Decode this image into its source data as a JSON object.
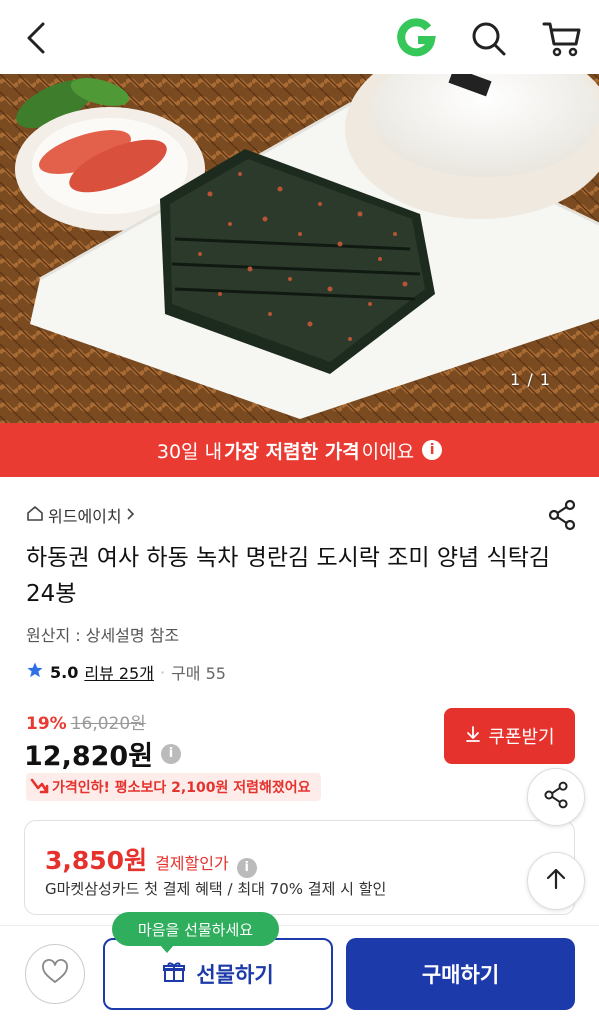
{
  "header": {
    "back_icon": "chevron-left-icon",
    "logo_icon": "g-logo-icon",
    "search_icon": "search-icon",
    "cart_icon": "cart-icon",
    "logo_color": "#35c759"
  },
  "hero": {
    "counter": "1 / 1"
  },
  "banner": {
    "prefix": "30일 내 ",
    "strong": "가장 저렴한 가격",
    "suffix": "이에요",
    "color": "#ea3b32"
  },
  "product": {
    "seller": "위드에이치",
    "title": "하동권 여사 하동 녹차 명란김 도시락 조미 양념 식탁김 24봉",
    "origin": "원산지 : 상세설명 참조",
    "rating": "5.0",
    "review_label": "리뷰 25개",
    "purchase_label": "구매 55"
  },
  "pricing": {
    "discount_pct": "19%",
    "original_price": "16,020원",
    "sale_price": "12,820원",
    "coupon_label": "쿠폰받기",
    "price_cut_note": "가격인하! 평소보다 2,100원 저렴해졌어요"
  },
  "card_offer": {
    "amount": "3,850원",
    "label": "결제할인가",
    "description": "G마켓삼성카드 첫 결제 혜택 / 최대 70% 결제 시 할인"
  },
  "bottom": {
    "gift_tooltip": "마음을 선물하세요",
    "gift_label": "선물하기",
    "buy_label": "구매하기",
    "primary_color": "#1c3aa9"
  }
}
